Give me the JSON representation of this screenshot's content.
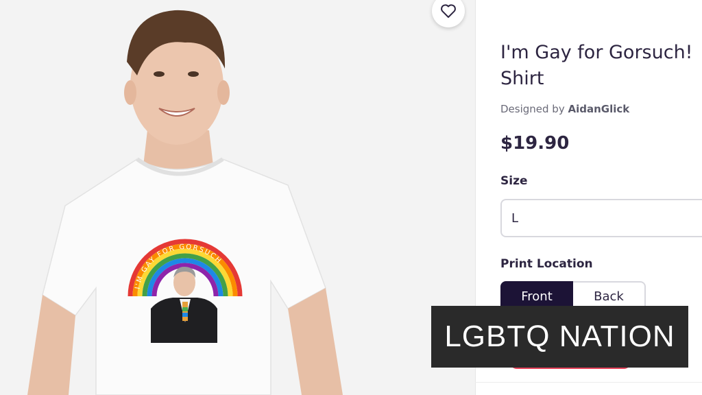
{
  "product": {
    "title": "I'm Gay for Gorsuch! Shirt",
    "designed_prefix": "Designed by",
    "designer": "AidanGlick",
    "price": "$19.90"
  },
  "options": {
    "size_label": "Size",
    "size_value": "L",
    "print_location_label": "Print Location",
    "front_label": "Front",
    "back_label": "Back",
    "selected": "Front"
  },
  "shirt_print": {
    "rainbow_text": "I'M GAY FOR GORSUCH"
  },
  "icons": {
    "favorite": "heart-outline-icon"
  },
  "overlay": {
    "logo_text": "LGBTQ NATION"
  },
  "colors": {
    "primary_dark": "#1c1336",
    "cta": "#e8425a",
    "text": "#2d2541"
  }
}
